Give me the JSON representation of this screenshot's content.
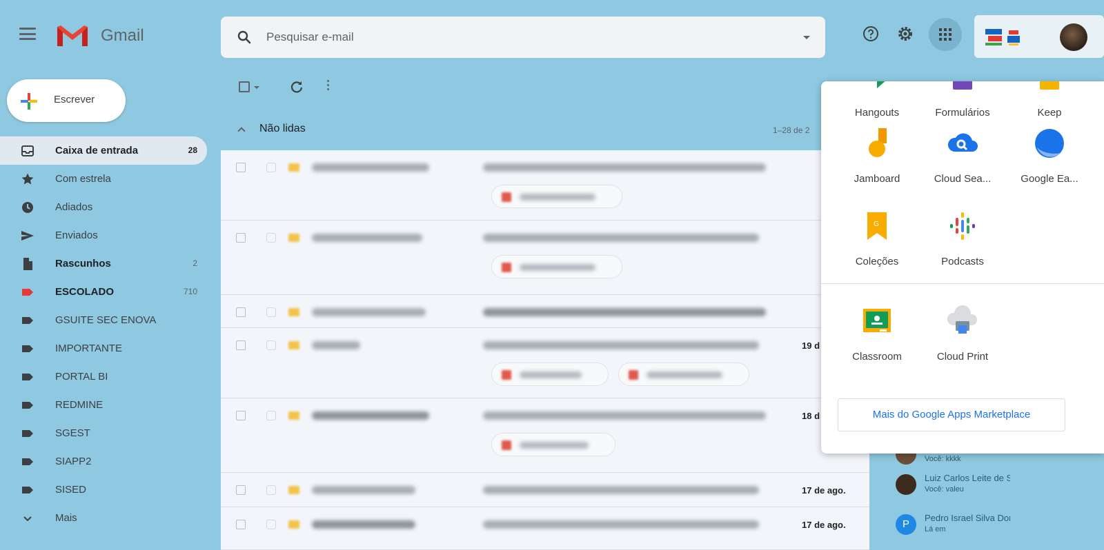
{
  "app": {
    "name": "Gmail"
  },
  "search": {
    "placeholder": "Pesquisar e-mail"
  },
  "compose": {
    "label": "Escrever"
  },
  "sidebar": {
    "items": [
      {
        "label": "Caixa de entrada",
        "count": "28",
        "icon": "inbox-icon",
        "active": true
      },
      {
        "label": "Com estrela",
        "count": "",
        "icon": "star-icon"
      },
      {
        "label": "Adiados",
        "count": "",
        "icon": "clock-icon"
      },
      {
        "label": "Enviados",
        "count": "",
        "icon": "send-icon"
      },
      {
        "label": "Rascunhos",
        "count": "2",
        "icon": "draft-icon",
        "bold": true
      },
      {
        "label": "ESCOLADO",
        "count": "710",
        "icon": "label-icon",
        "bold": true,
        "color": "#e53935"
      },
      {
        "label": "GSUITE SEC ENOVA",
        "count": "",
        "icon": "label-icon"
      },
      {
        "label": "IMPORTANTE",
        "count": "",
        "icon": "label-icon"
      },
      {
        "label": "PORTAL BI",
        "count": "",
        "icon": "label-icon"
      },
      {
        "label": "REDMINE",
        "count": "",
        "icon": "label-icon"
      },
      {
        "label": "SGEST",
        "count": "",
        "icon": "label-icon"
      },
      {
        "label": "SIAPP2",
        "count": "",
        "icon": "label-icon"
      },
      {
        "label": "SISED",
        "count": "",
        "icon": "label-icon"
      },
      {
        "label": "Mais",
        "count": "",
        "icon": "chevron-down-icon"
      }
    ]
  },
  "list": {
    "section_title": "Não lidas",
    "range": "1–28 de 2",
    "dates": [
      "19 d",
      "18 d",
      "17 de ago.",
      "17 de ago."
    ]
  },
  "apps_menu": {
    "top_row": [
      "Hangouts",
      "Formulários",
      "Keep"
    ],
    "row2": [
      "Jamboard",
      "Cloud Sea...",
      "Google Ea..."
    ],
    "row3": [
      "Coleções",
      "Podcasts"
    ],
    "more": [
      "Classroom",
      "Cloud Print"
    ],
    "marketplace_label": "Mais do Google Apps Marketplace"
  },
  "chat": [
    {
      "name": "",
      "sub": "Você: kkkk",
      "avatar_color": "#6b4f3a"
    },
    {
      "name": "Luiz Carlos Leite de S",
      "sub": "Você: valeu",
      "avatar_color": "#3d2b1f"
    },
    {
      "name": "Pedro Israel Silva Dor",
      "sub": "Lá em",
      "avatar_color": "#1e88e5",
      "initial": "P"
    }
  ],
  "colors": {
    "background": "#8ec9e1",
    "accent": "#1a73e8",
    "important": "#f5c24a",
    "label_red": "#e53935"
  }
}
